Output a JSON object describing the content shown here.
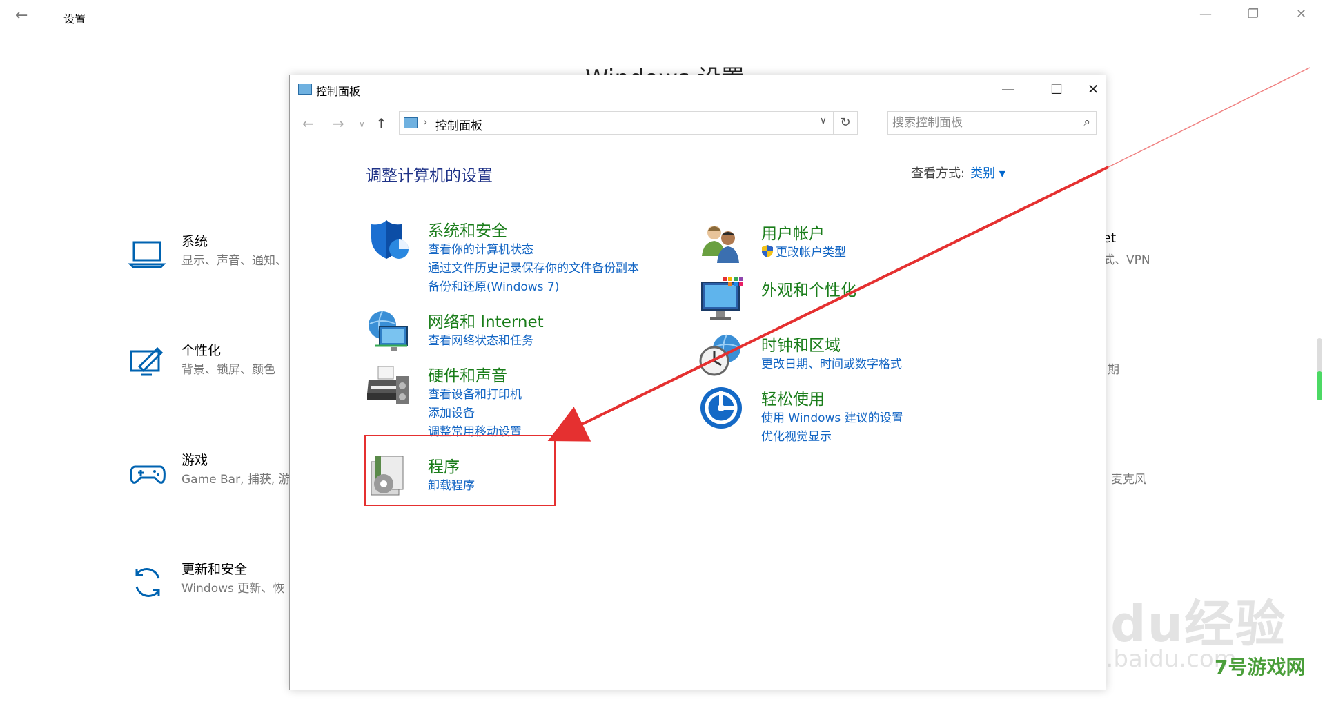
{
  "bg": {
    "title": "设置",
    "heading": "Windows 设置",
    "tiles": [
      {
        "name": "系统",
        "desc": "显示、声音、通知、",
        "icon": "laptop-icon"
      },
      {
        "name": "个性化",
        "desc": "背景、锁屏、颜色",
        "icon": "personalize-icon"
      },
      {
        "name": "游戏",
        "desc": "Game Bar, 捕获, 游",
        "icon": "gamepad-icon"
      },
      {
        "name": "更新和安全",
        "desc": "Windows 更新、恢",
        "icon": "update-icon"
      }
    ],
    "right_fragments": [
      "et",
      "式、VPN",
      "期",
      "麦克风"
    ],
    "watermark": "Baidu经验",
    "watermark_url": "jingyan.baidu.com",
    "corner_logo": "7号游戏网"
  },
  "cp": {
    "title": "控制面板",
    "address": "控制面板",
    "search_placeholder": "搜索控制面板",
    "heading": "调整计算机的设置",
    "viewby_label": "查看方式:",
    "viewby_value": "类别 ▾",
    "categories": [
      {
        "name": "系统和安全",
        "links": [
          "查看你的计算机状态",
          "通过文件历史记录保存你的文件备份副本",
          "备份和还原(Windows 7)"
        ]
      },
      {
        "name": "网络和 Internet",
        "links": [
          "查看网络状态和任务"
        ]
      },
      {
        "name": "硬件和声音",
        "links": [
          "查看设备和打印机",
          "添加设备",
          "调整常用移动设置"
        ]
      },
      {
        "name": "程序",
        "links": [
          "卸载程序"
        ]
      },
      {
        "name": "用户帐户",
        "links": [
          "更改帐户类型"
        ]
      },
      {
        "name": "外观和个性化",
        "links": []
      },
      {
        "name": "时钟和区域",
        "links": [
          "更改日期、时间或数字格式"
        ]
      },
      {
        "name": "轻松使用",
        "links": [
          "使用 Windows 建议的设置",
          "优化视觉显示"
        ]
      }
    ]
  },
  "colors": {
    "accent_link": "#1466c4",
    "category_green": "#1a7d1a",
    "highlight_red": "#e53030"
  }
}
